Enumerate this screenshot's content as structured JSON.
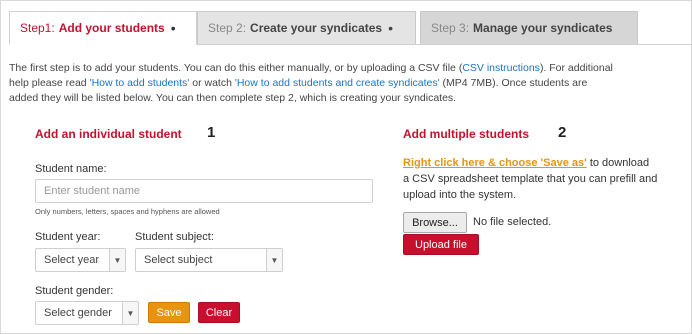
{
  "tabs": [
    {
      "num": "Step1:",
      "title": "Add your students",
      "dot": "•"
    },
    {
      "num": "Step 2:",
      "title": "Create your syndicates",
      "dot": "•"
    },
    {
      "num": "Step 3:",
      "title": "Manage your syndicates"
    }
  ],
  "intro": {
    "line1_a": "The first step is to add your students. You can do this either manually, or by uploading a CSV file (",
    "line1_link": "CSV instructions",
    "line1_b": "). For additional",
    "line2_a": "help please read ",
    "line2_link1": "'How to add students'",
    "line2_b": " or watch ",
    "line2_link2": "'How to add students and create syndicates'",
    "line2_c": " (MP4 7MB). Once students are",
    "line3": "added they will be listed below. You can then complete step 2, which is creating your syndicates."
  },
  "individual": {
    "heading": "Add an individual student",
    "badge": "1",
    "name_label": "Student name:",
    "name_placeholder": "Enter student name",
    "name_hint": "Only numbers, letters, spaces and hyphens are allowed",
    "year_label": "Student year:",
    "year_value": "Select year",
    "subject_label": "Student subject:",
    "subject_value": "Select subject",
    "gender_label": "Student gender:",
    "gender_value": "Select gender",
    "save_label": "Save",
    "clear_label": "Clear"
  },
  "multiple": {
    "heading": "Add multiple students",
    "badge": "2",
    "link_text": "Right click here & choose 'Save as'",
    "desc_1": " to download",
    "desc_2": "a CSV spreadsheet template that you can prefill and",
    "desc_3": "upload into the system.",
    "browse_label": "Browse...",
    "file_status": "No file selected.",
    "upload_label": "Upload file"
  },
  "icons": {
    "caret": "chevron-down-icon"
  },
  "colors": {
    "accent": "#c8102e",
    "save": "#e8940f",
    "link": "#1a73c8"
  }
}
